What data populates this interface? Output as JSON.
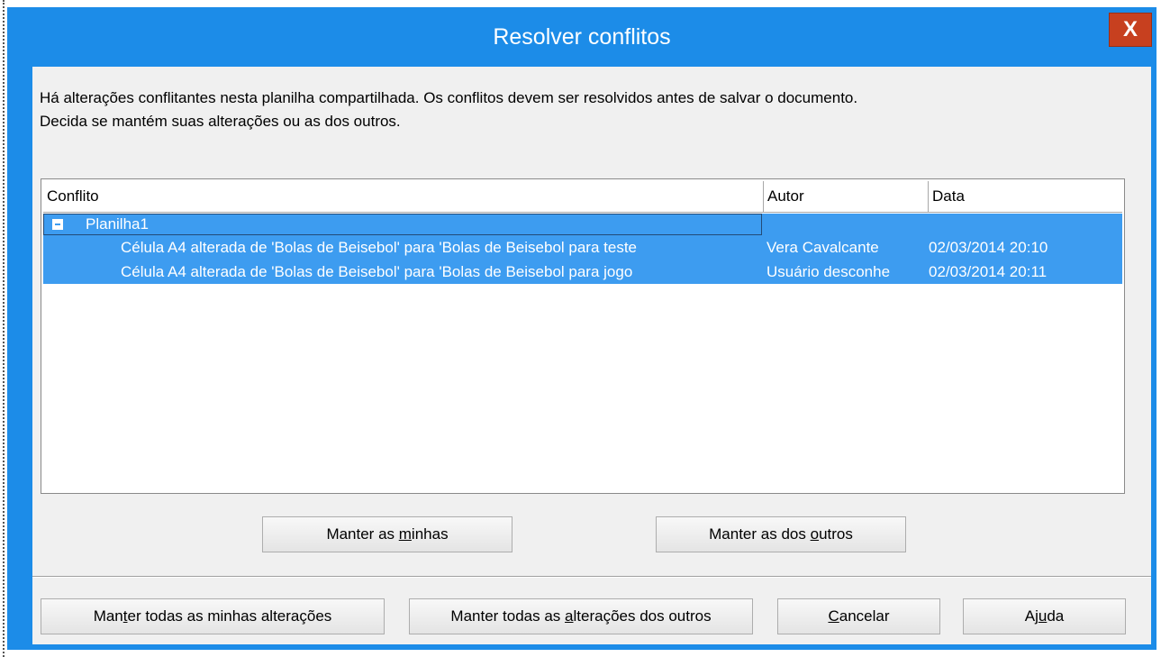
{
  "window": {
    "title": "Resolver conflitos",
    "close_label": "X"
  },
  "message": {
    "line1": "Há alterações conflitantes nesta planilha compartilhada. Os conflitos devem ser resolvidos antes de salvar o documento.",
    "line2": "Decida se mantém suas alterações ou as dos outros."
  },
  "table": {
    "headers": {
      "conflito": "Conflito",
      "autor": "Autor",
      "data": "Data"
    },
    "group": {
      "label": "Planilha1",
      "expanded": true
    },
    "rows": [
      {
        "conflito": "Célula A4 alterada de 'Bolas de Beisebol' para 'Bolas de Beisebol para teste",
        "autor": "Vera Cavalcante",
        "data": "02/03/2014 20:10"
      },
      {
        "conflito": "Célula A4 alterada de 'Bolas de Beisebol' para 'Bolas de Beisebol para jogo",
        "autor": "Usuário desconhe",
        "data": "02/03/2014 20:11"
      }
    ],
    "selection_color": "#3d9cf0"
  },
  "buttons": {
    "keep_mine": {
      "pre": "Manter as ",
      "accel": "m",
      "post": "inhas"
    },
    "keep_others": {
      "pre": "Manter as dos ",
      "accel": "o",
      "post": "utros"
    },
    "keep_all_mine": {
      "pre": "Man",
      "accel": "t",
      "post": "er todas as minhas alterações"
    },
    "keep_all_others": {
      "pre": "Manter todas as ",
      "accel": "a",
      "post": "lterações dos outros"
    },
    "cancel": {
      "pre": "",
      "accel": "C",
      "post": "ancelar"
    },
    "help": {
      "pre": "Aj",
      "accel": "u",
      "post": "da"
    }
  },
  "colors": {
    "titlebar": "#1c8ce8",
    "close_button": "#c7401f",
    "dialog_background": "#f0f0f0"
  }
}
